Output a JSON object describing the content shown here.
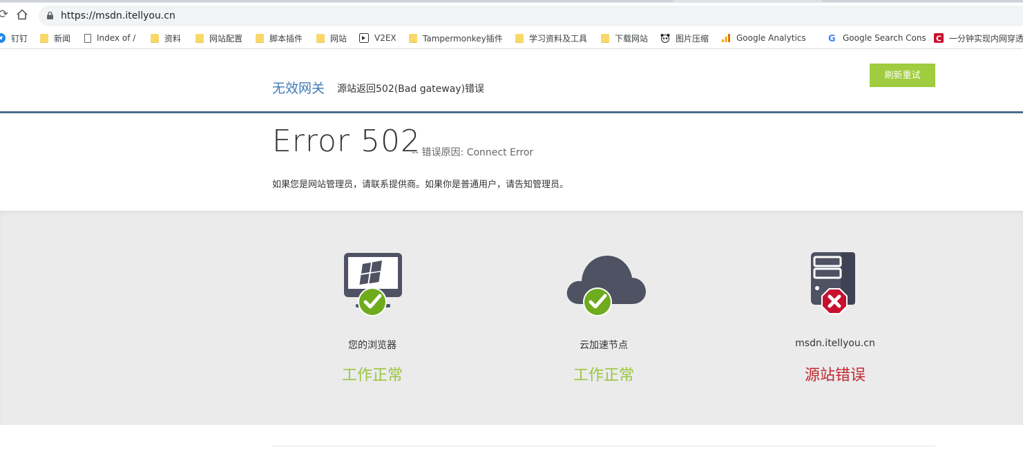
{
  "browser": {
    "url": "https://msdn.itellyou.cn",
    "bookmarks": [
      {
        "label": "钉钉",
        "icon": "dingtalk-icon"
      },
      {
        "label": "新闻",
        "icon": "folder-icon"
      },
      {
        "label": "Index of /",
        "icon": "page-icon"
      },
      {
        "label": "资料",
        "icon": "folder-icon"
      },
      {
        "label": "网站配置",
        "icon": "folder-icon"
      },
      {
        "label": "脚本插件",
        "icon": "folder-icon"
      },
      {
        "label": "网站",
        "icon": "folder-icon"
      },
      {
        "label": "V2EX",
        "icon": "v2ex-icon"
      },
      {
        "label": "Tampermonkey插件",
        "icon": "folder-icon"
      },
      {
        "label": "学习资料及工具",
        "icon": "folder-icon"
      },
      {
        "label": "下载网站",
        "icon": "folder-icon"
      },
      {
        "label": "图片压缩",
        "icon": "panda-icon"
      },
      {
        "label": "Google Analytics",
        "icon": "analytics-icon"
      },
      {
        "label": "Google Search Cons",
        "icon": "google-icon"
      },
      {
        "label": "一分钟实现内网穿透",
        "icon": "c-logo-icon"
      }
    ]
  },
  "header": {
    "title": "无效网关",
    "subtitle": "源站返回502(Bad gateway)错误",
    "retry_label": "刷新重试"
  },
  "error": {
    "code": "Error 502",
    "reason": "-- 错误原因: Connect Error",
    "message": "如果您是网站管理员，请联系提供商。如果你是普通用户，请告知管理员。"
  },
  "status": [
    {
      "label": "您的浏览器",
      "state": "工作正常",
      "ok": true,
      "icon": "monitor-icon"
    },
    {
      "label": "云加速节点",
      "state": "工作正常",
      "ok": true,
      "icon": "cloud-icon"
    },
    {
      "label": "msdn.itellyou.cn",
      "state": "源站错误",
      "ok": false,
      "icon": "server-icon"
    }
  ],
  "colors": {
    "ok": "#9bc441",
    "error": "#c0282f",
    "accent": "#3d7ab8",
    "button": "#a0cc3f",
    "icon": "#4e5263"
  }
}
